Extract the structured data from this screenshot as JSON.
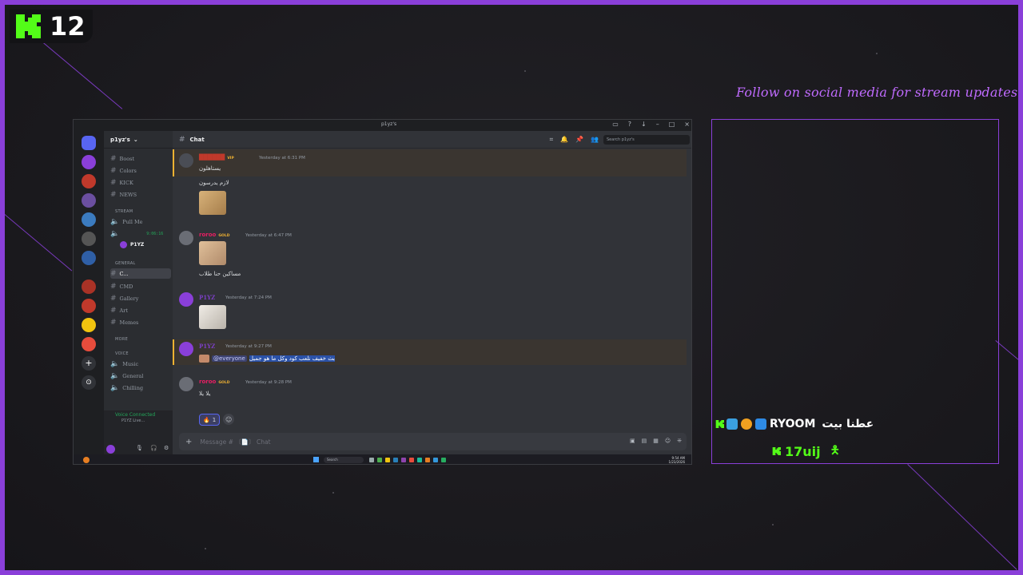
{
  "kick_badge": {
    "number": "12"
  },
  "follow_text": "Follow on social media for stream updates",
  "camera": {
    "line1_name": "RYOOM",
    "line1_arabic": "عطنا بيت",
    "line2_text": "17uij"
  },
  "discord": {
    "window_title": "p1yz's",
    "server_name": "p1yz's",
    "channel_title": "Chat",
    "search_placeholder": "Search p1yz's",
    "channels": [
      {
        "name": "Boost"
      },
      {
        "name": "Colors"
      },
      {
        "name": "KICK"
      },
      {
        "name": "NEWS"
      }
    ],
    "cat_stream": "STREAM",
    "stream_channels": [
      {
        "name": "Pull Me"
      }
    ],
    "voice_timer": "9:06:16",
    "voice_user": "P1YZ",
    "cat_general": "GENERAL",
    "general_channels": [
      {
        "name": "C..."
      },
      {
        "name": "CMD"
      },
      {
        "name": "Gallery"
      },
      {
        "name": "Art"
      },
      {
        "name": "Memes"
      }
    ],
    "cat_more": "MORE",
    "cat_voice": "VOICE",
    "voice_channels": [
      {
        "name": "Music"
      },
      {
        "name": "General"
      },
      {
        "name": "Chilling"
      }
    ],
    "voice_connected": "Voice Connected",
    "voice_status": "P1YZ Live...",
    "messages": [
      {
        "user": "",
        "badge": "VIP",
        "timestamp": "Yesterday at 6:31 PM",
        "lines": [
          "يستاهلون",
          "لازم يدرسون"
        ]
      },
      {
        "user": "roroo",
        "badge": "GOLD",
        "timestamp": "Yesterday at 6:47 PM",
        "lines": [
          "مساكين حنا طلاب"
        ]
      },
      {
        "user": "P1YZ",
        "badge": "",
        "timestamp": "Yesterday at 7:24 PM",
        "lines": []
      },
      {
        "user": "P1YZ",
        "badge": "",
        "timestamp": "Yesterday at 9:27 PM",
        "mention": "@everyone",
        "text": "بث خفيف نلعب كود وكل ما هو جميل"
      },
      {
        "user": "roroo",
        "badge": "GOLD",
        "timestamp": "Yesterday at 9:28 PM",
        "lines": [
          "يلا يلا"
        ]
      }
    ],
    "reaction": {
      "emoji": "🔥",
      "count": "1"
    },
    "composer_placeholder": "Message # 〔📄〕 Chat",
    "taskbar_search": "Search",
    "clock_time": "9:54 AM",
    "clock_date": "1/23/2026"
  },
  "colors": {
    "accent_purple": "#8a3fd9",
    "kick_green": "#53fc18",
    "follow_pink": "#c06bff"
  }
}
